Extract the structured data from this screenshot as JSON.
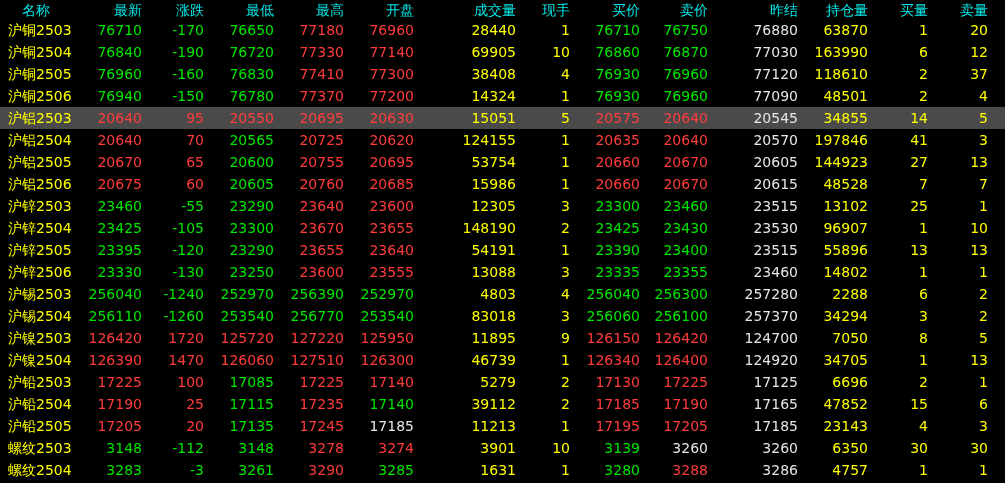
{
  "columns": [
    "名称",
    "最新",
    "涨跌",
    "最低",
    "最高",
    "开盘",
    "成交量",
    "现手",
    "买价",
    "卖价",
    "昨结",
    "持仓量",
    "买量",
    "卖量"
  ],
  "rows": [
    {
      "name": "沪铜2503",
      "selected": false,
      "cells": [
        {
          "text": "76710",
          "color": "#00e600"
        },
        {
          "text": "-170",
          "color": "#00e600"
        },
        {
          "text": "76650",
          "color": "#00e600"
        },
        {
          "text": "77180",
          "color": "#ff3c3c"
        },
        {
          "text": "76960",
          "color": "#ff3c3c"
        },
        "28440",
        "1",
        {
          "text": "76710",
          "color": "#00e600"
        },
        {
          "text": "76750",
          "color": "#00e600"
        },
        "76880",
        "63870",
        "1",
        "20"
      ]
    },
    {
      "name": "沪铜2504",
      "selected": false,
      "cells": [
        {
          "text": "76840",
          "color": "#00e600"
        },
        {
          "text": "-190",
          "color": "#00e600"
        },
        {
          "text": "76720",
          "color": "#00e600"
        },
        {
          "text": "77330",
          "color": "#ff3c3c"
        },
        {
          "text": "77140",
          "color": "#ff3c3c"
        },
        "69905",
        "10",
        {
          "text": "76860",
          "color": "#00e600"
        },
        {
          "text": "76870",
          "color": "#00e600"
        },
        "77030",
        "163990",
        "6",
        "12"
      ]
    },
    {
      "name": "沪铜2505",
      "selected": false,
      "cells": [
        {
          "text": "76960",
          "color": "#00e600"
        },
        {
          "text": "-160",
          "color": "#00e600"
        },
        {
          "text": "76830",
          "color": "#00e600"
        },
        {
          "text": "77410",
          "color": "#ff3c3c"
        },
        {
          "text": "77300",
          "color": "#ff3c3c"
        },
        "38408",
        "4",
        {
          "text": "76930",
          "color": "#00e600"
        },
        {
          "text": "76960",
          "color": "#00e600"
        },
        "77120",
        "118610",
        "2",
        "37"
      ]
    },
    {
      "name": "沪铜2506",
      "selected": false,
      "cells": [
        {
          "text": "76940",
          "color": "#00e600"
        },
        {
          "text": "-150",
          "color": "#00e600"
        },
        {
          "text": "76780",
          "color": "#00e600"
        },
        {
          "text": "77370",
          "color": "#ff3c3c"
        },
        {
          "text": "77200",
          "color": "#ff3c3c"
        },
        "14324",
        "1",
        {
          "text": "76930",
          "color": "#00e600"
        },
        {
          "text": "76960",
          "color": "#00e600"
        },
        "77090",
        "48501",
        "2",
        "4"
      ]
    },
    {
      "name": "沪铝2503",
      "selected": true,
      "cells": [
        {
          "text": "20640",
          "color": "#ff3c3c"
        },
        {
          "text": "95",
          "color": "#ff3c3c"
        },
        {
          "text": "20550",
          "color": "#ff3c3c"
        },
        {
          "text": "20695",
          "color": "#ff3c3c"
        },
        {
          "text": "20630",
          "color": "#ff3c3c"
        },
        "15051",
        "5",
        {
          "text": "20575",
          "color": "#ff3c3c"
        },
        {
          "text": "20640",
          "color": "#ff3c3c"
        },
        "20545",
        "34855",
        "14",
        "5"
      ]
    },
    {
      "name": "沪铝2504",
      "selected": false,
      "cells": [
        {
          "text": "20640",
          "color": "#ff3c3c"
        },
        {
          "text": "70",
          "color": "#ff3c3c"
        },
        {
          "text": "20565",
          "color": "#00e600"
        },
        {
          "text": "20725",
          "color": "#ff3c3c"
        },
        {
          "text": "20620",
          "color": "#ff3c3c"
        },
        "124155",
        "1",
        {
          "text": "20635",
          "color": "#ff3c3c"
        },
        {
          "text": "20640",
          "color": "#ff3c3c"
        },
        "20570",
        "197846",
        "41",
        "3"
      ]
    },
    {
      "name": "沪铝2505",
      "selected": false,
      "cells": [
        {
          "text": "20670",
          "color": "#ff3c3c"
        },
        {
          "text": "65",
          "color": "#ff3c3c"
        },
        {
          "text": "20600",
          "color": "#00e600"
        },
        {
          "text": "20755",
          "color": "#ff3c3c"
        },
        {
          "text": "20695",
          "color": "#ff3c3c"
        },
        "53754",
        "1",
        {
          "text": "20660",
          "color": "#ff3c3c"
        },
        {
          "text": "20670",
          "color": "#ff3c3c"
        },
        "20605",
        "144923",
        "27",
        "13"
      ]
    },
    {
      "name": "沪铝2506",
      "selected": false,
      "cells": [
        {
          "text": "20675",
          "color": "#ff3c3c"
        },
        {
          "text": "60",
          "color": "#ff3c3c"
        },
        {
          "text": "20605",
          "color": "#00e600"
        },
        {
          "text": "20760",
          "color": "#ff3c3c"
        },
        {
          "text": "20685",
          "color": "#ff3c3c"
        },
        "15986",
        "1",
        {
          "text": "20660",
          "color": "#ff3c3c"
        },
        {
          "text": "20670",
          "color": "#ff3c3c"
        },
        "20615",
        "48528",
        "7",
        "7"
      ]
    },
    {
      "name": "沪锌2503",
      "selected": false,
      "cells": [
        {
          "text": "23460",
          "color": "#00e600"
        },
        {
          "text": "-55",
          "color": "#00e600"
        },
        {
          "text": "23290",
          "color": "#00e600"
        },
        {
          "text": "23640",
          "color": "#ff3c3c"
        },
        {
          "text": "23600",
          "color": "#ff3c3c"
        },
        "12305",
        "3",
        {
          "text": "23300",
          "color": "#00e600"
        },
        {
          "text": "23460",
          "color": "#00e600"
        },
        "23515",
        "13102",
        "25",
        "1"
      ]
    },
    {
      "name": "沪锌2504",
      "selected": false,
      "cells": [
        {
          "text": "23425",
          "color": "#00e600"
        },
        {
          "text": "-105",
          "color": "#00e600"
        },
        {
          "text": "23300",
          "color": "#00e600"
        },
        {
          "text": "23670",
          "color": "#ff3c3c"
        },
        {
          "text": "23655",
          "color": "#ff3c3c"
        },
        "148190",
        "2",
        {
          "text": "23425",
          "color": "#00e600"
        },
        {
          "text": "23430",
          "color": "#00e600"
        },
        "23530",
        "96907",
        "1",
        "10"
      ]
    },
    {
      "name": "沪锌2505",
      "selected": false,
      "cells": [
        {
          "text": "23395",
          "color": "#00e600"
        },
        {
          "text": "-120",
          "color": "#00e600"
        },
        {
          "text": "23290",
          "color": "#00e600"
        },
        {
          "text": "23655",
          "color": "#ff3c3c"
        },
        {
          "text": "23640",
          "color": "#ff3c3c"
        },
        "54191",
        "1",
        {
          "text": "23390",
          "color": "#00e600"
        },
        {
          "text": "23400",
          "color": "#00e600"
        },
        "23515",
        "55896",
        "13",
        "13"
      ]
    },
    {
      "name": "沪锌2506",
      "selected": false,
      "cells": [
        {
          "text": "23330",
          "color": "#00e600"
        },
        {
          "text": "-130",
          "color": "#00e600"
        },
        {
          "text": "23250",
          "color": "#00e600"
        },
        {
          "text": "23600",
          "color": "#ff3c3c"
        },
        {
          "text": "23555",
          "color": "#ff3c3c"
        },
        "13088",
        "3",
        {
          "text": "23335",
          "color": "#00e600"
        },
        {
          "text": "23355",
          "color": "#00e600"
        },
        "23460",
        "14802",
        "1",
        "1"
      ]
    },
    {
      "name": "沪锡2503",
      "selected": false,
      "cells": [
        {
          "text": "256040",
          "color": "#00e600"
        },
        {
          "text": "-1240",
          "color": "#00e600"
        },
        {
          "text": "252970",
          "color": "#00e600"
        },
        {
          "text": "256390",
          "color": "#00e600"
        },
        {
          "text": "252970",
          "color": "#00e600"
        },
        "4803",
        "4",
        {
          "text": "256040",
          "color": "#00e600"
        },
        {
          "text": "256300",
          "color": "#00e600"
        },
        "257280",
        "2288",
        "6",
        "2"
      ]
    },
    {
      "name": "沪锡2504",
      "selected": false,
      "cells": [
        {
          "text": "256110",
          "color": "#00e600"
        },
        {
          "text": "-1260",
          "color": "#00e600"
        },
        {
          "text": "253540",
          "color": "#00e600"
        },
        {
          "text": "256770",
          "color": "#00e600"
        },
        {
          "text": "253540",
          "color": "#00e600"
        },
        "83018",
        "3",
        {
          "text": "256060",
          "color": "#00e600"
        },
        {
          "text": "256100",
          "color": "#00e600"
        },
        "257370",
        "34294",
        "3",
        "2"
      ]
    },
    {
      "name": "沪镍2503",
      "selected": false,
      "cells": [
        {
          "text": "126420",
          "color": "#ff3c3c"
        },
        {
          "text": "1720",
          "color": "#ff3c3c"
        },
        {
          "text": "125720",
          "color": "#ff3c3c"
        },
        {
          "text": "127220",
          "color": "#ff3c3c"
        },
        {
          "text": "125950",
          "color": "#ff3c3c"
        },
        "11895",
        "9",
        {
          "text": "126150",
          "color": "#ff3c3c"
        },
        {
          "text": "126420",
          "color": "#ff3c3c"
        },
        "124700",
        "7050",
        "8",
        "5"
      ]
    },
    {
      "name": "沪镍2504",
      "selected": false,
      "cells": [
        {
          "text": "126390",
          "color": "#ff3c3c"
        },
        {
          "text": "1470",
          "color": "#ff3c3c"
        },
        {
          "text": "126060",
          "color": "#ff3c3c"
        },
        {
          "text": "127510",
          "color": "#ff3c3c"
        },
        {
          "text": "126300",
          "color": "#ff3c3c"
        },
        "46739",
        "1",
        {
          "text": "126340",
          "color": "#ff3c3c"
        },
        {
          "text": "126400",
          "color": "#ff3c3c"
        },
        "124920",
        "34705",
        "1",
        "13"
      ]
    },
    {
      "name": "沪铅2503",
      "selected": false,
      "cells": [
        {
          "text": "17225",
          "color": "#ff3c3c"
        },
        {
          "text": "100",
          "color": "#ff3c3c"
        },
        {
          "text": "17085",
          "color": "#00e600"
        },
        {
          "text": "17225",
          "color": "#ff3c3c"
        },
        {
          "text": "17140",
          "color": "#ff3c3c"
        },
        "5279",
        "2",
        {
          "text": "17130",
          "color": "#ff3c3c"
        },
        {
          "text": "17225",
          "color": "#ff3c3c"
        },
        "17125",
        "6696",
        "2",
        "1"
      ]
    },
    {
      "name": "沪铅2504",
      "selected": false,
      "cells": [
        {
          "text": "17190",
          "color": "#ff3c3c"
        },
        {
          "text": "25",
          "color": "#ff3c3c"
        },
        {
          "text": "17115",
          "color": "#00e600"
        },
        {
          "text": "17235",
          "color": "#ff3c3c"
        },
        {
          "text": "17140",
          "color": "#00e600"
        },
        "39112",
        "2",
        {
          "text": "17185",
          "color": "#ff3c3c"
        },
        {
          "text": "17190",
          "color": "#ff3c3c"
        },
        "17165",
        "47852",
        "15",
        "6"
      ]
    },
    {
      "name": "沪铅2505",
      "selected": false,
      "cells": [
        {
          "text": "17205",
          "color": "#ff3c3c"
        },
        {
          "text": "20",
          "color": "#ff3c3c"
        },
        {
          "text": "17135",
          "color": "#00e600"
        },
        {
          "text": "17245",
          "color": "#ff3c3c"
        },
        {
          "text": "17185",
          "color": "#e6e6e6"
        },
        "11213",
        "1",
        {
          "text": "17195",
          "color": "#ff3c3c"
        },
        {
          "text": "17205",
          "color": "#ff3c3c"
        },
        "17185",
        "23143",
        "4",
        "3"
      ]
    },
    {
      "name": "螺纹2503",
      "selected": false,
      "cells": [
        {
          "text": "3148",
          "color": "#00e600"
        },
        {
          "text": "-112",
          "color": "#00e600"
        },
        {
          "text": "3148",
          "color": "#00e600"
        },
        {
          "text": "3278",
          "color": "#ff3c3c"
        },
        {
          "text": "3274",
          "color": "#ff3c3c"
        },
        "3901",
        "10",
        {
          "text": "3139",
          "color": "#00e600"
        },
        {
          "text": "3260",
          "color": "#e6e6e6"
        },
        "3260",
        "6350",
        "30",
        "30"
      ]
    },
    {
      "name": "螺纹2504",
      "selected": false,
      "cells": [
        {
          "text": "3283",
          "color": "#00e600"
        },
        {
          "text": "-3",
          "color": "#00e600"
        },
        {
          "text": "3261",
          "color": "#00e600"
        },
        {
          "text": "3290",
          "color": "#ff3c3c"
        },
        {
          "text": "3285",
          "color": "#00e600"
        },
        "1631",
        "1",
        {
          "text": "3280",
          "color": "#00e600"
        },
        {
          "text": "3288",
          "color": "#ff3c3c"
        },
        "3286",
        "4757",
        "1",
        "1"
      ]
    }
  ]
}
